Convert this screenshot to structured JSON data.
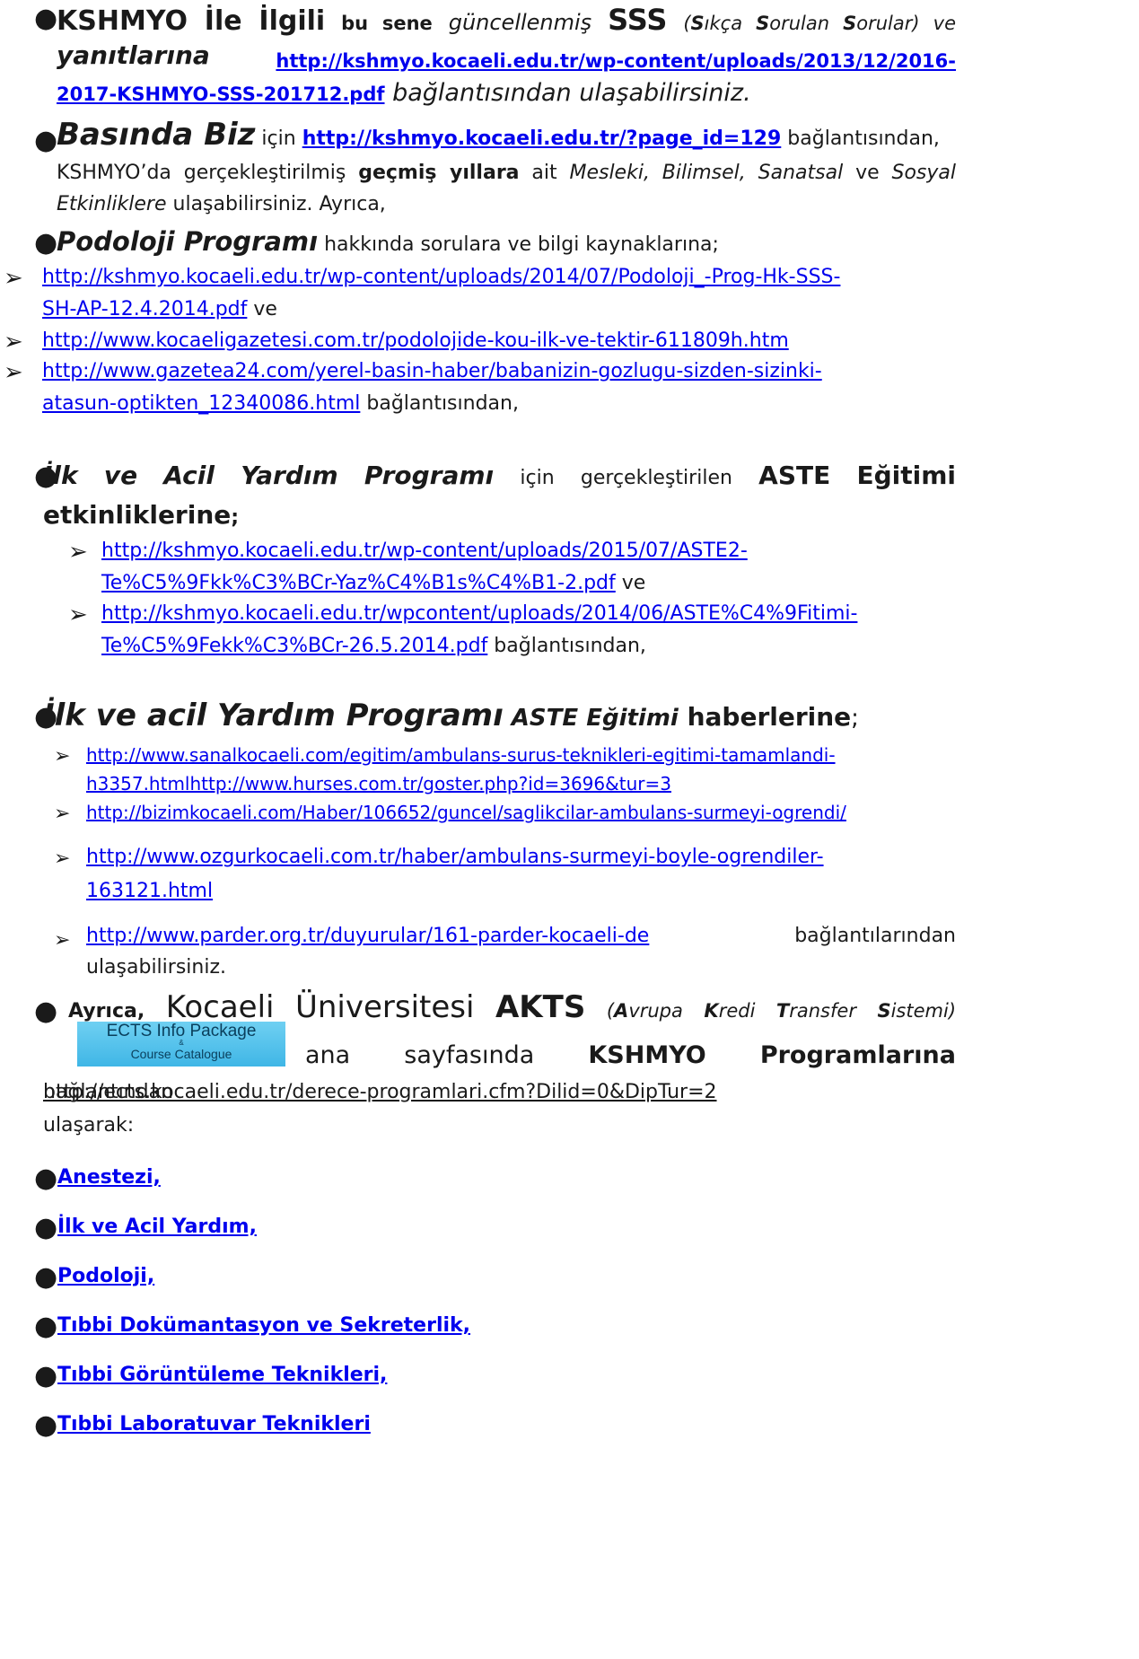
{
  "s1": {
    "a": "KSHMYO İle İlgili",
    "b": "bu sene",
    "c": "güncellenmiş",
    "d": "SSS",
    "e1": "(",
    "e2": "S",
    "e3": "ıkça ",
    "e4": "S",
    "e5": "orulan ",
    "e6": "S",
    "e7": "orular) ve",
    "f": "yanıtlarına",
    "link1": "http://kshmyo.kocaeli.edu.tr/wp-content/uploads/2013/12/2016-",
    "link2": "2017-KSHMYO-SSS-201712.pdf",
    "tail": " bağlantısından ulaşabilirsiniz."
  },
  "s2": {
    "title": "Basında Biz",
    "icin": " için ",
    "link": "http://kshmyo.kocaeli.edu.tr/?page_id=129",
    "tail1": " bağlantısından,",
    "l2a": "KSHMYO’da gerçekleştirilmiş ",
    "l2b": "geçmiş yıllara",
    "l2c": " ait ",
    "l2d": "Mesleki, Bilimsel, Sanatsal",
    "l2e": " ve ",
    "l2f": "Sosyal",
    "l3a": "Etkinliklere",
    "l3b": " ulaşabilirsiniz. Ayrıca,"
  },
  "s3": {
    "title": "Podoloji Programı",
    "tail": " hakkında sorulara ve bilgi kaynaklarına;",
    "links": [
      {
        "l1": "http://kshmyo.kocaeli.edu.tr/wp-content/uploads/2014/07/Podoloji_-Prog-Hk-SSS-",
        "l2": "SH-AP-12.4.2014.pdf",
        "after": "  ve"
      },
      {
        "l1": "http://www.kocaeligazetesi.com.tr/podolojide-kou-ilk-ve-tektir-611809h.htm",
        "l2": "",
        "after": ""
      },
      {
        "l1": "http://www.gazetea24.com/yerel-basin-haber/babanizin-gozlugu-sizden-sizinki-",
        "l2": "atasun-optikten_12340086.html",
        "after": "  bağlantısından,"
      }
    ]
  },
  "s4": {
    "w1": "İlk",
    "w2": "ve",
    "w3": "Acil",
    "w4": "Yardım",
    "w5": "Programı",
    "w6": "için",
    "w7": "gerçekleştirilen",
    "w8": "ASTE",
    "w9": "Eğitimi",
    "line2": "etkinliklerine",
    "semi": ";",
    "links": [
      {
        "l1": "http://kshmyo.kocaeli.edu.tr/wp-content/uploads/2015/07/ASTE2-",
        "l2": "Te%C5%9Fkk%C3%BCr-Yaz%C4%B1s%C4%B1-2.pdf",
        "after": "  ve"
      },
      {
        "l1": "http://kshmyo.kocaeli.edu.tr/wpcontent/uploads/2014/06/ASTE%C4%9Fitimi-",
        "l2": "Te%C5%9Fekk%C3%BCr-26.5.2014.pdf",
        "after": " bağlantısından,"
      }
    ]
  },
  "s5": {
    "a": "İlk ve acil Yardım Programı",
    "b": " ASTE Eğitimi",
    "c": " haberlerine",
    "d": ";",
    "links": [
      {
        "l1": "http://www.sanalkocaeli.com/egitim/ambulans-surus-teknikleri-egitimi-tamamlandi-",
        "l2": "h3357.htmlhttp://www.hurses.com.tr/goster.php?id=3696&tur=3"
      },
      {
        "l1": "http://bizimkocaeli.com/Haber/106652/guncel/saglikcilar-ambulans-surmeyi-ogrendi/",
        "l2": ""
      },
      {
        "l1": "http://www.ozgurkocaeli.com.tr/haber/ambulans-surmeyi-boyle-ogrendiler-",
        "l2": "163121.html"
      },
      {
        "l1": "http://www.parder.org.tr/duyurular/161-parder-kocaeli-de",
        "l2": ""
      }
    ],
    "last_after": "bağlantılarından",
    "last_line2": "ulaşabilirsiniz."
  },
  "s6": {
    "ayrica": "Ayrıca,",
    "kocaeli": "Kocaeli",
    "univ": "Üniversitesi",
    "akts": "AKTS",
    "p1": "(",
    "A": "A",
    "vrupa": "vrupa",
    "K": "K",
    "redi": "redi",
    "T": "T",
    "ransfer": "ransfer",
    "S": "S",
    "istemi": "istemi)",
    "logo_l1": "ECTS Info Package",
    "logo_l2": "&",
    "logo_l3": "Course Catalogue",
    "ana": "ana",
    "sayfasinda": "sayfasında",
    "kshmyo": "KSHMYO",
    "programlarina": "Programlarına",
    "link": "http://ects.kocaeli.edu.tr/derece-programlari.cfm?Dilid=0&DipTur=2",
    "baglantidan": "bağlantından",
    "ulasarak": "ulaşarak:"
  },
  "programs": [
    "Anestezi,",
    "İlk ve Acil Yardım,",
    "Podoloji,",
    "Tıbbi Dokümantasyon ve Sekreterlik,",
    "Tıbbi Görüntüleme Teknikleri,",
    "Tıbbi Laboratuvar Teknikleri"
  ],
  "glyphs": {
    "bullet": "●",
    "arrow": "➢"
  }
}
